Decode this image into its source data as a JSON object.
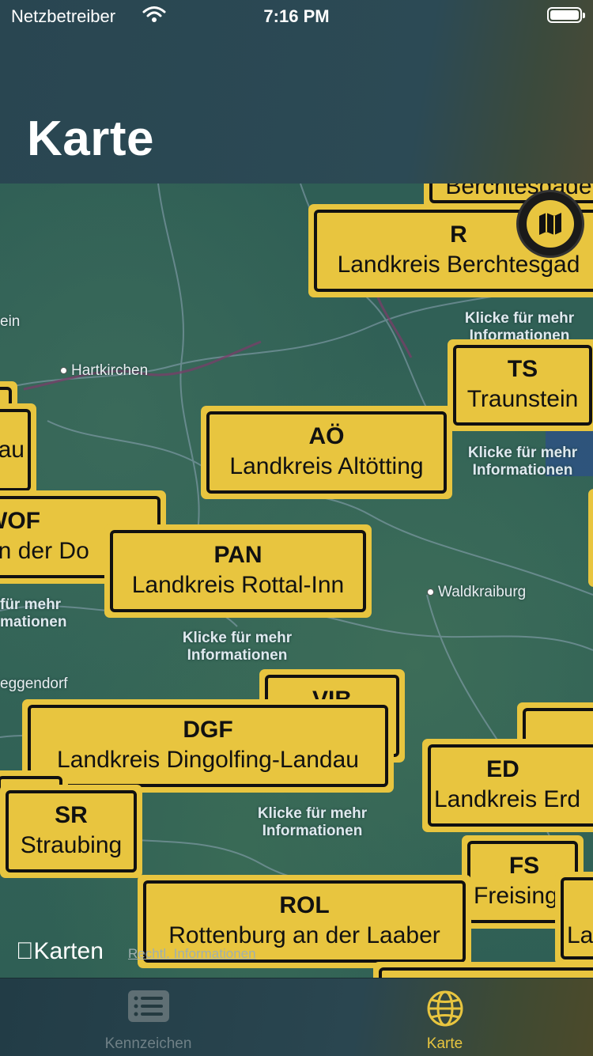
{
  "status_bar": {
    "carrier": "Netzbetreiber",
    "time": "7:16 PM"
  },
  "nav": {
    "title": "Karte"
  },
  "map": {
    "places": [
      {
        "name": "ein",
        "dot": false
      },
      {
        "name": "Hartkirchen",
        "dot": true
      },
      {
        "name": "Waldkraiburg",
        "dot": true
      },
      {
        "name": "eggendorf",
        "dot": false
      }
    ],
    "hints": [
      "Klicke für mehr Informationen",
      "Klicke für mehr Informationen",
      "Klicke für mehr Informationen",
      "Klicke für mehr Informationen",
      "für mehr mationen"
    ],
    "signs": [
      {
        "code": "",
        "name": "Berchtesgade"
      },
      {
        "code": "R",
        "name": "Landkreis Berchtesgad"
      },
      {
        "code": "TS",
        "name": "Traunstein"
      },
      {
        "code": "AÖ",
        "name": "Landkreis Altötting"
      },
      {
        "code": "",
        "name": "au"
      },
      {
        "code": "WOF",
        "name": "an der Do"
      },
      {
        "code": "PAN",
        "name": "Landkreis Rottal-Inn"
      },
      {
        "code": "VIB",
        "name": ""
      },
      {
        "code": "DGF",
        "name": "Landkreis Dingolfing-Landau"
      },
      {
        "code": "ED",
        "name": "Landkreis Erd"
      },
      {
        "code": "SR",
        "name": "Straubing"
      },
      {
        "code": "FS",
        "name": "Freising"
      },
      {
        "code": "ROL",
        "name": "Rottenburg an der Laaber"
      },
      {
        "code": "",
        "name": "La"
      }
    ],
    "maps_logo": "Karten",
    "legal": "Rechtl. Informationen"
  },
  "tabs": [
    {
      "label": "Kennzeichen",
      "icon": "list-icon",
      "active": false
    },
    {
      "label": "Karte",
      "icon": "globe-icon",
      "active": true
    }
  ],
  "colors": {
    "sign_yellow": "#e8c53f",
    "active_tab": "#e8c53f",
    "inactive_tab": "#6f8086"
  }
}
